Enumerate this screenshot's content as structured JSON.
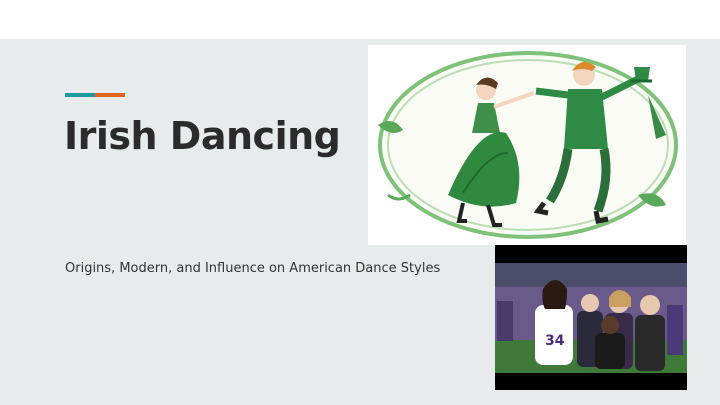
{
  "slide": {
    "title": "Irish Dancing",
    "subtitle": "Origins, Modern, and Influence on American Dance Styles"
  },
  "colors": {
    "background": "#e8ebec",
    "accent_teal": "#1a9ba0",
    "accent_orange": "#e0631d",
    "title_text": "#2b2b2b"
  },
  "images": {
    "illustration": "irish-dancers-illustration",
    "photo": "football-player-group-photo"
  }
}
